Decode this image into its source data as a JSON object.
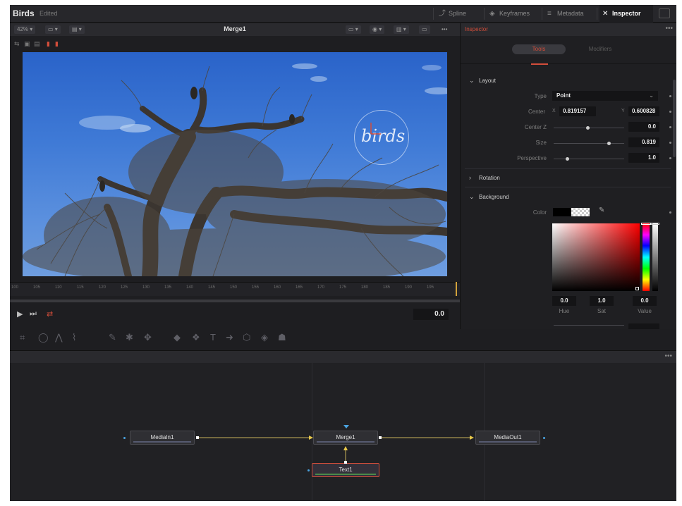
{
  "app": {
    "title": "Birds",
    "status": "Edited"
  },
  "top_tabs": [
    {
      "label": "Spline",
      "icon": "spline-icon",
      "active": false
    },
    {
      "label": "Keyframes",
      "icon": "keyframes-icon",
      "active": false
    },
    {
      "label": "Metadata",
      "icon": "metadata-icon",
      "active": false
    },
    {
      "label": "Inspector",
      "icon": "inspector-icon",
      "active": true
    }
  ],
  "viewer": {
    "zoom": "42% ▾",
    "title": "Merge1",
    "watermark_text": "birds",
    "ruler_ticks": [
      "100",
      "105",
      "110",
      "115",
      "120",
      "125",
      "130",
      "135",
      "140",
      "145",
      "150",
      "155",
      "160",
      "165",
      "170",
      "175",
      "180",
      "185",
      "190",
      "195"
    ],
    "time": "0.0"
  },
  "inspector": {
    "panel_title": "Inspector",
    "tabs": {
      "tools": "Tools",
      "modifiers": "Modifiers"
    },
    "layout": {
      "title": "Layout",
      "type_label": "Type",
      "type_value": "Point",
      "center_label": "Center",
      "center_x_label": "X",
      "center_x": "0.819157",
      "center_y_label": "Y",
      "center_y": "0.600828",
      "center_z_label": "Center Z",
      "center_z": "0.0",
      "size_label": "Size",
      "size": "0.819",
      "perspective_label": "Perspective",
      "perspective": "1.0"
    },
    "rotation": {
      "title": "Rotation"
    },
    "background": {
      "title": "Background",
      "color_label": "Color",
      "hue": "0.0",
      "sat": "1.0",
      "value": "0.0",
      "hue_label": "Hue",
      "sat_label": "Sat",
      "value_label": "Value",
      "picker_color": "#ff0000"
    }
  },
  "nodes": {
    "media_in": "MediaIn1",
    "merge": "Merge1",
    "media_out": "MediaOut1",
    "text": "Text1"
  },
  "colors": {
    "accent": "#d34d3a",
    "panel_bg": "#1e1e21",
    "sky": "#3f7ad6"
  }
}
